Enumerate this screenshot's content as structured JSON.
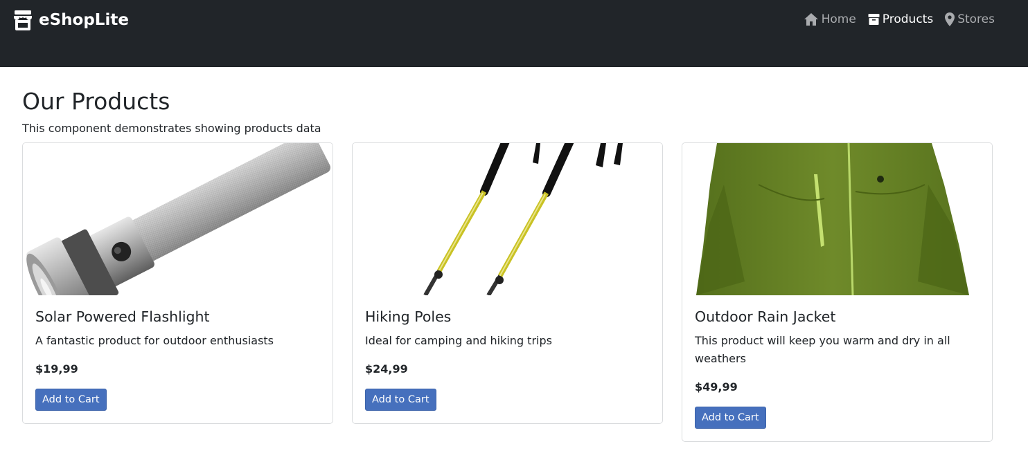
{
  "header": {
    "brand": "eShopLite",
    "brand_icon": "shop-icon",
    "nav": [
      {
        "label": "Home",
        "icon": "home-icon",
        "active": false
      },
      {
        "label": "Products",
        "icon": "products-box-icon",
        "active": true
      },
      {
        "label": "Stores",
        "icon": "location-pin-icon",
        "active": false
      }
    ]
  },
  "page": {
    "title": "Our Products",
    "subtitle": "This component demonstrates showing products data"
  },
  "products": [
    {
      "name": "Solar Powered Flashlight",
      "description": "A fantastic product for outdoor enthusiasts",
      "price": "$19,99",
      "button": "Add to Cart"
    },
    {
      "name": "Hiking Poles",
      "description": "Ideal for camping and hiking trips",
      "price": "$24,99",
      "button": "Add to Cart"
    },
    {
      "name": "Outdoor Rain Jacket",
      "description": "This product will keep you warm and dry in all weathers",
      "price": "$49,99",
      "button": "Add to Cart"
    }
  ],
  "colors": {
    "navbar": "#212529",
    "primary_button": "#4670bd",
    "nav_active": "#ffffff",
    "nav_inactive": "#a9abae"
  }
}
